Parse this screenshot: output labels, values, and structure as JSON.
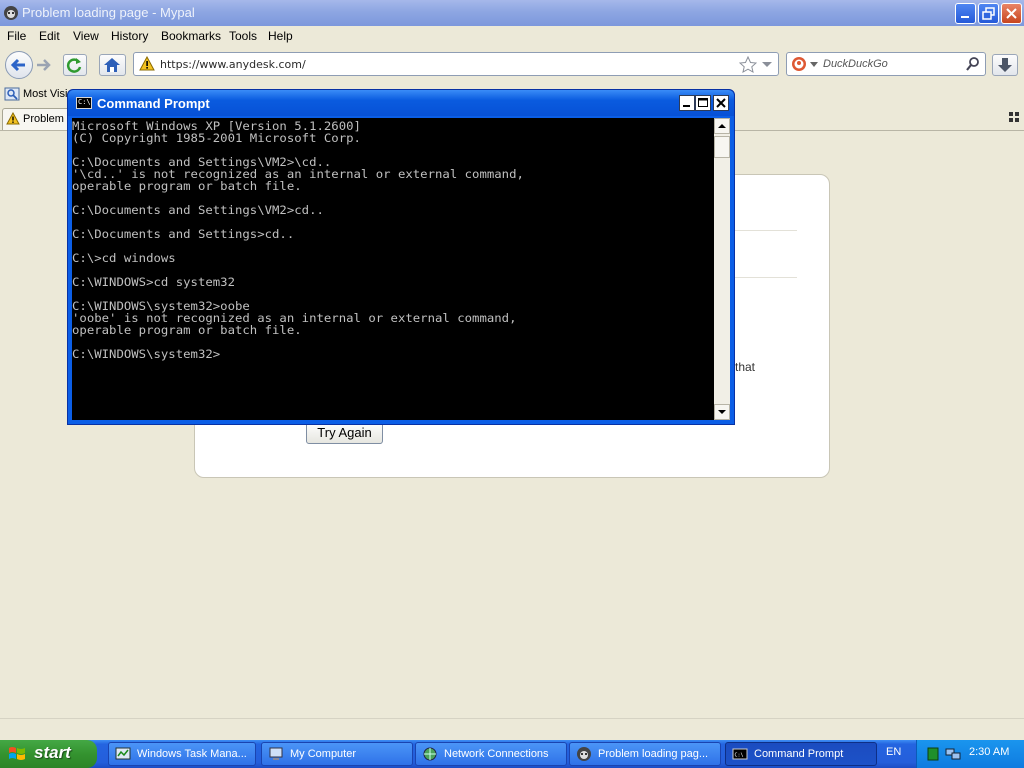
{
  "browser": {
    "title": "Problem loading page - Mypal",
    "menu": [
      "File",
      "Edit",
      "View",
      "History",
      "Bookmarks",
      "Tools",
      "Help"
    ],
    "url": "https://www.anydesk.com/",
    "search_placeholder": "DuckDuckGo",
    "bookmark_label": "Most Visi",
    "tab_label": "Problem l",
    "error_page": {
      "visible_text": "that",
      "try_again_label": "Try Again"
    }
  },
  "cmd": {
    "title": "Command Prompt",
    "lines": [
      "Microsoft Windows XP [Version 5.1.2600]",
      "(C) Copyright 1985-2001 Microsoft Corp.",
      "",
      "C:\\Documents and Settings\\VM2>\\cd..",
      "'\\cd..' is not recognized as an internal or external command,",
      "operable program or batch file.",
      "",
      "C:\\Documents and Settings\\VM2>cd..",
      "",
      "C:\\Documents and Settings>cd..",
      "",
      "C:\\>cd windows",
      "",
      "C:\\WINDOWS>cd system32",
      "",
      "C:\\WINDOWS\\system32>oobe",
      "'oobe' is not recognized as an internal or external command,",
      "operable program or batch file.",
      "",
      "C:\\WINDOWS\\system32>"
    ]
  },
  "taskbar": {
    "start_label": "start",
    "tasks": [
      {
        "label": "Windows Task Mana...",
        "icon": "task-manager-icon"
      },
      {
        "label": "My Computer",
        "icon": "my-computer-icon"
      },
      {
        "label": "Network Connections",
        "icon": "network-connections-icon"
      },
      {
        "label": "Problem loading pag...",
        "icon": "mypal-browser-icon"
      },
      {
        "label": "Command Prompt",
        "icon": "command-prompt-icon",
        "active": true
      }
    ],
    "language": "EN",
    "clock": "2:30 AM"
  },
  "colors": {
    "xp_blue": "#0b5ee6",
    "start_green": "#34932f",
    "console_bg": "#000000",
    "console_fg": "#c0c0c0"
  }
}
